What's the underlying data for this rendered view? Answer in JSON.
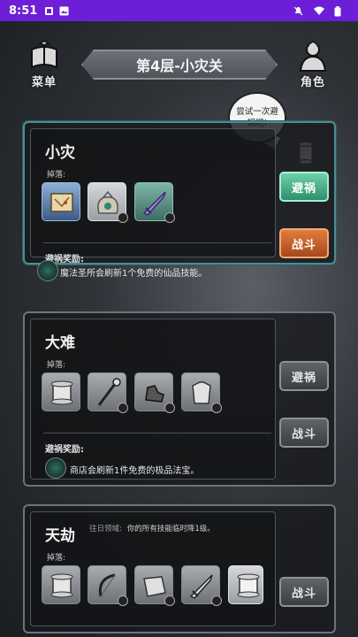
{
  "status_bar": {
    "time": "8:51"
  },
  "menu": {
    "label": "菜单",
    "icon": "menu-emblem-icon"
  },
  "role": {
    "label": "角色",
    "icon": "character-icon"
  },
  "level_title": "第4层-小灾关",
  "hint_bubble": "尝试一次避祸吧!",
  "cards": [
    {
      "title": "小灾",
      "drops_label": "掉落:",
      "items": [
        "scroll-map-icon",
        "gem-pouch-icon",
        "purple-sword-icon"
      ],
      "reward_label": "避祸奖励:",
      "reward_text": "魔法圣所会刷新1个免费的仙品技能。",
      "avoid_label": "避祸",
      "fight_label": "战斗"
    },
    {
      "title": "大难",
      "drops_label": "掉落:",
      "items": [
        "scroll-icon",
        "staff-icon",
        "gauntlet-icon",
        "armor-icon"
      ],
      "reward_label": "避祸奖励:",
      "reward_text": "商店会刷新1件免费的极品法宝。",
      "avoid_label": "避祸",
      "fight_label": "战斗"
    },
    {
      "title": "天劫",
      "curse_label": "往日领域:",
      "curse_text": "你的所有技能临时降1级。",
      "drops_label": "掉落:",
      "items": [
        "scroll-icon",
        "bow-icon",
        "cloth-icon",
        "sword-icon",
        "scroll-icon"
      ],
      "fight_label": "战斗"
    }
  ],
  "colors": {
    "status_bar": "#6c1fd6",
    "avoid_active": "#2e8f6c",
    "fight_active": "#a8481b",
    "active_border": "#4e8c93"
  }
}
